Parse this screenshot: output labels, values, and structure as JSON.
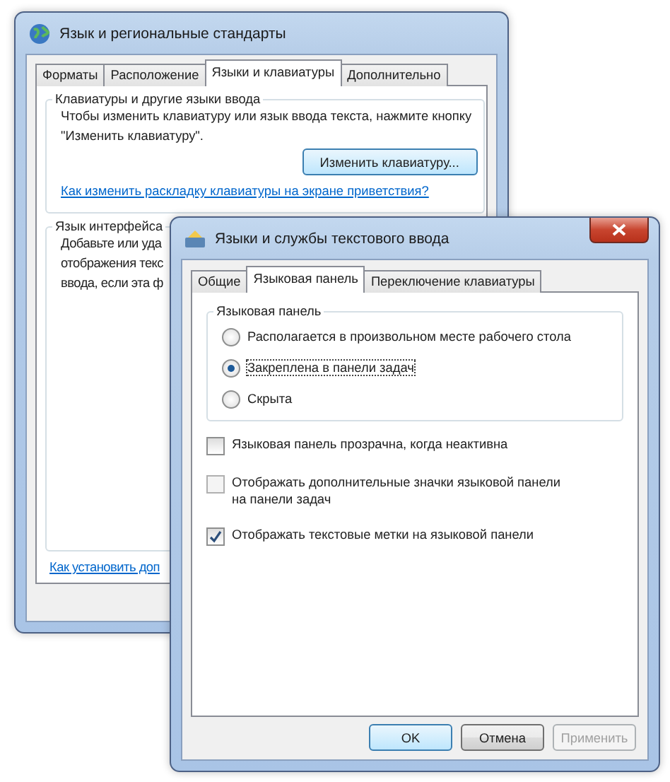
{
  "back_window": {
    "title": "Язык и региональные стандарты",
    "tabs": [
      {
        "label": "Форматы",
        "selected": false
      },
      {
        "label": "Расположение",
        "selected": false
      },
      {
        "label": "Языки и клавиатуры",
        "selected": true
      },
      {
        "label": "Дополнительно",
        "selected": false
      }
    ],
    "keyboards_group": {
      "legend": "Клавиатуры и другие языки ввода",
      "lines": [
        "Чтобы изменить клавиатуру или язык ввода текста, нажмите кнопку",
        "\"Изменить клавиатуру\"."
      ],
      "button": "Изменить клавиатуру...",
      "link": "Как изменить раскладку клавиатуры на экране приветствия?"
    },
    "interface_group": {
      "legend": "Язык интерфейса",
      "lines": [
        "Добавьте или уда",
        "отображения текс",
        "ввода, если эта ф"
      ]
    },
    "link": "Как установить доп"
  },
  "front_window": {
    "title": "Языки и службы текстового ввода",
    "tabs": [
      {
        "label": "Общие",
        "selected": false
      },
      {
        "label": "Языковая панель",
        "selected": true
      },
      {
        "label": "Переключение клавиатуры",
        "selected": false
      }
    ],
    "language_bar_group": {
      "legend": "Языковая панель",
      "options": [
        {
          "label": "Располагается в произвольном месте рабочего стола",
          "selected": false
        },
        {
          "label": "Закреплена в панели задач",
          "selected": true
        },
        {
          "label": "Скрыта",
          "selected": false
        }
      ]
    },
    "checkboxes": [
      {
        "label": "Языковая панель прозрачна, когда неактивна",
        "checked": false,
        "disabled": false
      },
      {
        "label": "Отображать дополнительные значки языковой панели на панели задач",
        "checked": false,
        "disabled": true
      },
      {
        "label": "Отображать текстовые метки на языковой панели",
        "checked": true,
        "disabled": false
      }
    ],
    "buttons": [
      {
        "label": "OK",
        "kind": "default",
        "disabled": false
      },
      {
        "label": "Отмена",
        "kind": "normal",
        "disabled": false
      },
      {
        "label": "Применить",
        "kind": "normal",
        "disabled": true
      }
    ]
  }
}
